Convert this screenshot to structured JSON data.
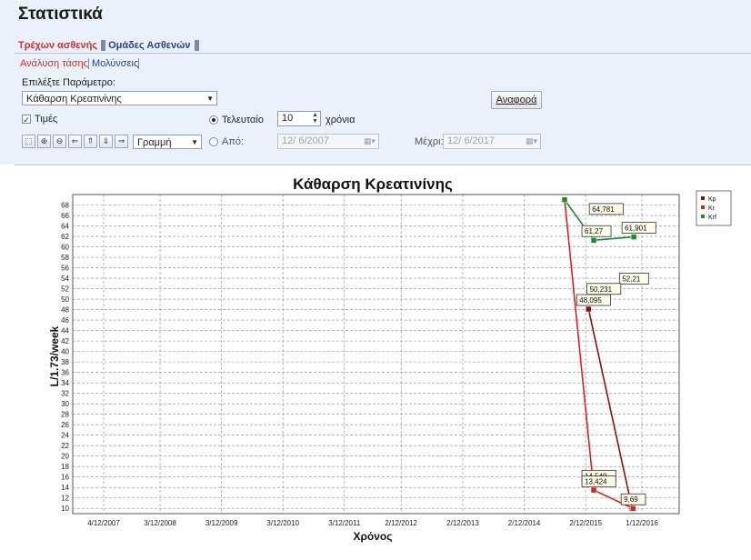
{
  "page": {
    "title": "Στατιστικά"
  },
  "tabs": [
    {
      "label": "Τρέχων ασθενής"
    },
    {
      "label": "Ομάδες Ασθενών"
    }
  ],
  "subtabs": [
    {
      "label": "Ανάλυση τάσης"
    },
    {
      "label": "Μολύνσεις"
    }
  ],
  "controls": {
    "param_label": "Επιλέξτε Παράμετρο:",
    "param_value": "Κάθαρση Κρεατινίνης",
    "report_button": "Αναφορά",
    "values_label": "Τιμές",
    "last_label": "Τελευταίο",
    "last_value": "10",
    "years_label": "χρόνια",
    "from_label": "Από:",
    "from_value": "12/ 6/2007",
    "to_label": "Μέχρι:",
    "to_value": "12/ 6/2017",
    "chart_type_value": "Γραμμή"
  },
  "colors": {
    "kp": "#8b1010",
    "kr": "#e02020",
    "krf": "#1e8a2a",
    "accent": "#d03030"
  },
  "icons": [
    "select-icon",
    "zoom-in-icon",
    "zoom-out-icon",
    "pan-left-icon",
    "pan-up-icon",
    "pan-down-icon",
    "pan-right-icon"
  ],
  "chart_data": {
    "type": "line",
    "title": "Κάθαρση Κρεατινίνης",
    "xlabel": "Χρόνος",
    "ylabel": "L/1.73/week",
    "ylim": [
      9,
      70
    ],
    "yticks": [
      10,
      12,
      14,
      16,
      18,
      20,
      22,
      24,
      26,
      28,
      30,
      32,
      34,
      36,
      38,
      40,
      42,
      44,
      46,
      48,
      50,
      52,
      54,
      56,
      58,
      60,
      62,
      64,
      66,
      68
    ],
    "xticks": [
      "4/12/2007",
      "3/12/2008",
      "3/12/2009",
      "3/12/2010",
      "3/12/2011",
      "2/12/2012",
      "2/12/2013",
      "2/12/2014",
      "2/12/2015",
      "1/12/2016"
    ],
    "grid": true,
    "legend_position": "top-right",
    "series": [
      {
        "name": "Kp",
        "color": "#8b1010",
        "points": [
          {
            "x": "2015-03-01",
            "y": 48.095,
            "label": "48,095"
          },
          {
            "x": "2015-11-15",
            "y": 10
          }
        ]
      },
      {
        "name": "Kr",
        "color": "#e02020",
        "points": [
          {
            "x": "2014-10-10",
            "y": 69
          },
          {
            "x": "2015-04-01",
            "y": 13.5
          },
          {
            "x": "2015-11-20",
            "y": 10,
            "label": "9,69"
          }
        ]
      },
      {
        "name": "Krf",
        "color": "#1e8a2a",
        "points": [
          {
            "x": "2014-10-10",
            "y": 69
          },
          {
            "x": "2015-04-01",
            "y": 61.27,
            "label": "61,27"
          },
          {
            "x": "2015-11-25",
            "y": 61.901,
            "label": "61,901"
          }
        ]
      }
    ],
    "annotations": [
      {
        "text": "64,781",
        "x": "2015-05-15",
        "y": 65.5
      },
      {
        "text": "61,27",
        "x": "2015-04-01",
        "y": 61.27
      },
      {
        "text": "61,901",
        "x": "2015-11-25",
        "y": 61.901
      },
      {
        "text": "52,21",
        "x": "2015-11-10",
        "y": 52.2
      },
      {
        "text": "50,231",
        "x": "2015-05-01",
        "y": 50.23
      },
      {
        "text": "48,095",
        "x": "2015-03-01",
        "y": 48.095
      },
      {
        "text": "14,549",
        "x": "2015-04-01",
        "y": 14.5
      },
      {
        "text": "13,424",
        "x": "2015-04-01",
        "y": 13.4
      },
      {
        "text": "9,69",
        "x": "2015-11-20",
        "y": 10
      }
    ]
  }
}
